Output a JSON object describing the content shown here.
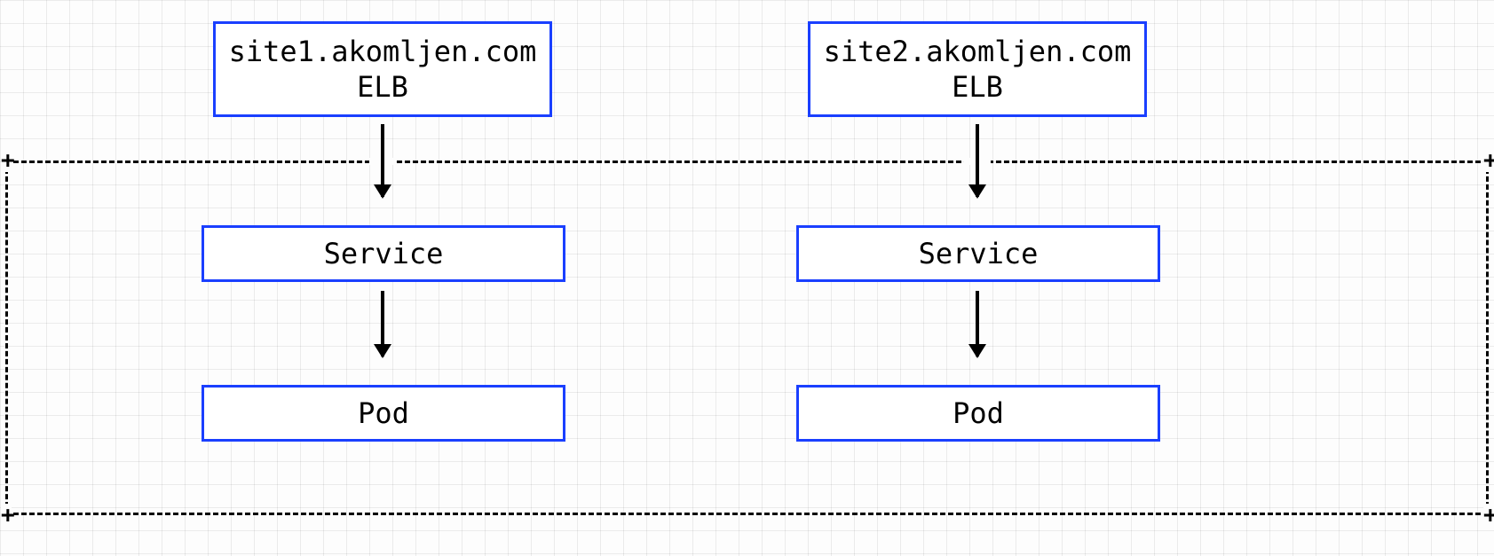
{
  "columns": [
    {
      "elb": {
        "line1": "site1.akomljen.com",
        "line2": "ELB"
      },
      "service": "Service",
      "pod": "Pod"
    },
    {
      "elb": {
        "line1": "site2.akomljen.com",
        "line2": "ELB"
      },
      "service": "Service",
      "pod": "Pod"
    }
  ],
  "corner_glyph": "+"
}
